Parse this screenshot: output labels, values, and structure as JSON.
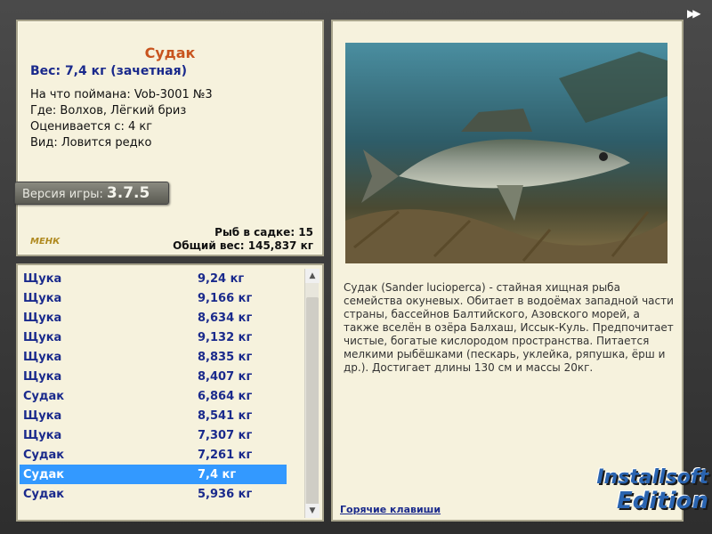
{
  "fish": {
    "name": "Судак",
    "weight_line": "Вес: 7,4 кг (зачетная)",
    "caught_on": "На что поймана: Vob-3001 №3",
    "where": "Где: Волхов, Лёгкий бриз",
    "rated_from": "Оценивается с: 4 кг",
    "kind": "Вид: Ловится редко"
  },
  "version": {
    "label": "Версия игры:",
    "number": "3.7.5"
  },
  "mini_logo": "МЕНК",
  "totals": {
    "count_line": "Рыб в садке: 15",
    "weight_line": "Общий вес: 145,837 кг"
  },
  "catch_list": [
    {
      "name": "Щука",
      "weight": "9,24 кг"
    },
    {
      "name": "Щука",
      "weight": "9,166 кг"
    },
    {
      "name": "Щука",
      "weight": "8,634 кг"
    },
    {
      "name": "Щука",
      "weight": "9,132 кг"
    },
    {
      "name": "Щука",
      "weight": "8,835 кг"
    },
    {
      "name": "Щука",
      "weight": "8,407 кг"
    },
    {
      "name": "Судак",
      "weight": "6,864 кг"
    },
    {
      "name": "Щука",
      "weight": "8,541 кг"
    },
    {
      "name": "Щука",
      "weight": "7,307 кг"
    },
    {
      "name": "Судак",
      "weight": "7,261 кг"
    },
    {
      "name": "Судак",
      "weight": "7,4 кг"
    },
    {
      "name": "Судак",
      "weight": "5,936 кг"
    }
  ],
  "selected_index": 10,
  "description": "Судак (Sander lucioperca) - стайная хищная рыба семейства окуневых. Обитает в водоёмах западной части страны, бассейнов Балтийского, Азовского морей, а также вселён в озёра Балхаш, Иссык-Куль. Предпочитает чистые, богатые кислородом пространства. Питается мелкими рыбёшками (пескарь, уклейка, ряпушка, ёрш и др.). Достигает длины 130 см и массы 20кг.",
  "hotkeys_link": "Горячие клавиши",
  "watermark": {
    "line1": "Installsoft",
    "line2": "Edition"
  },
  "colors": {
    "title": "#c8541e",
    "list_text": "#1a2a8c",
    "selection": "#3399ff"
  }
}
